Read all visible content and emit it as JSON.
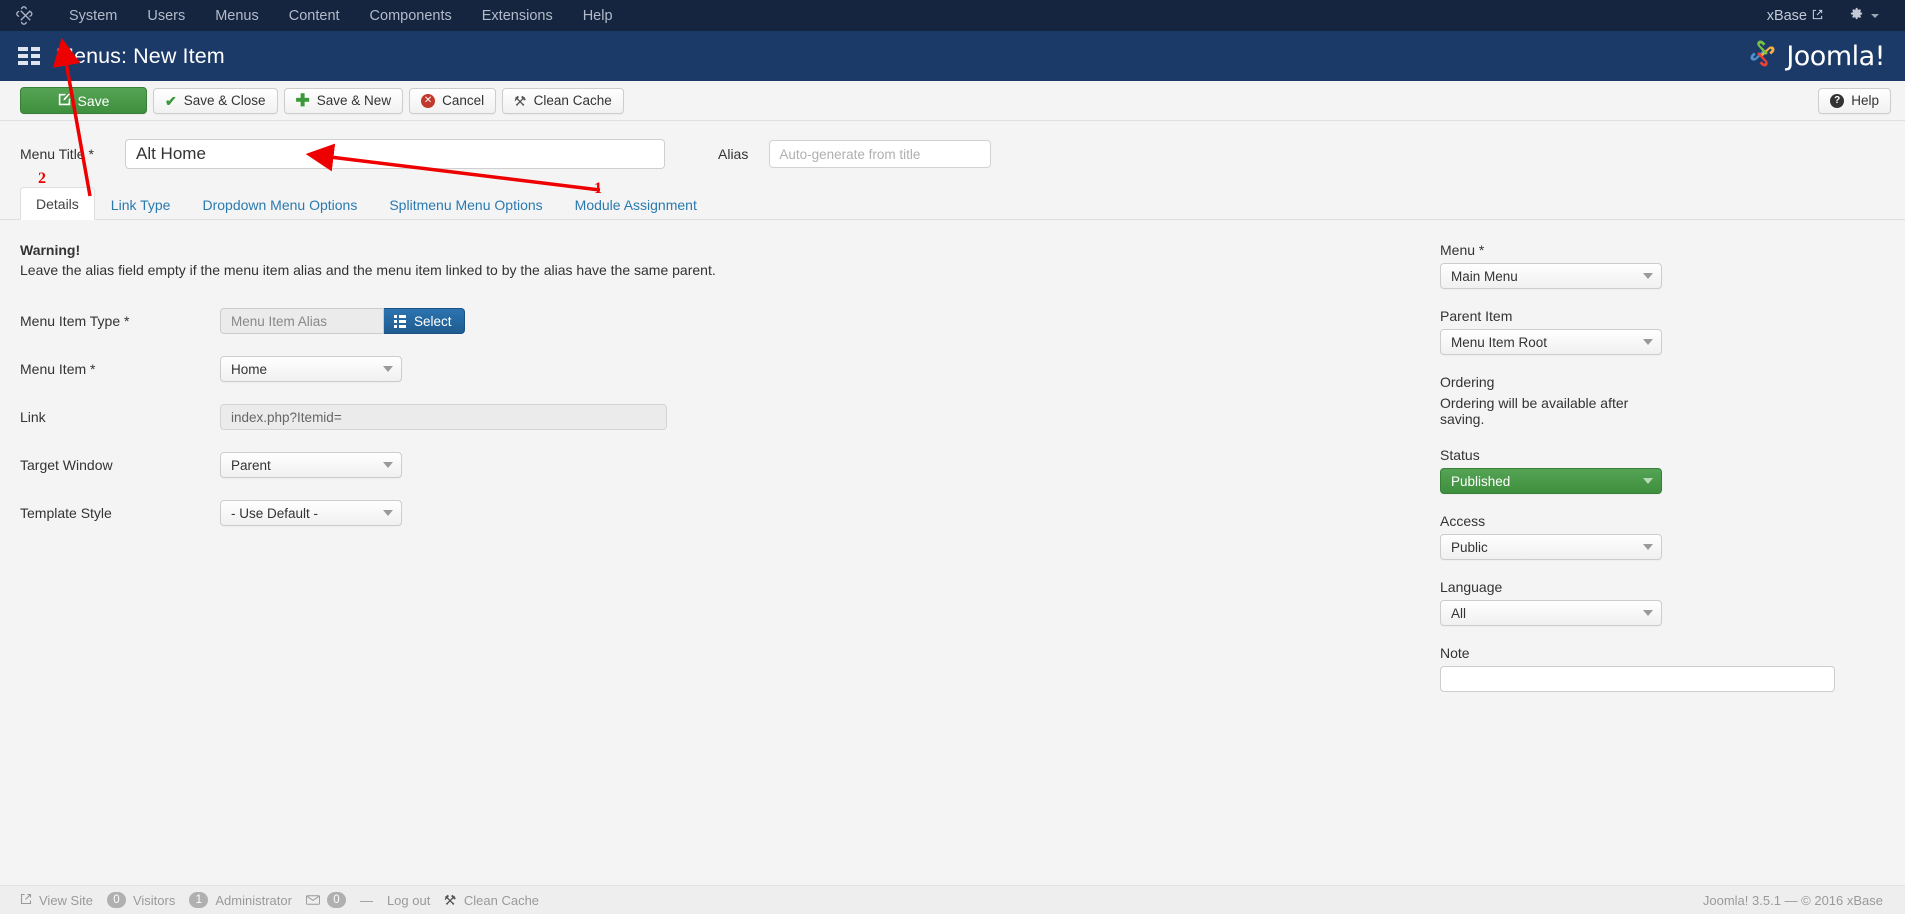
{
  "topbar": {
    "brand_icon": "joomla-mark-icon",
    "nav": [
      {
        "label": "System"
      },
      {
        "label": "Users"
      },
      {
        "label": "Menus"
      },
      {
        "label": "Content"
      },
      {
        "label": "Components"
      },
      {
        "label": "Extensions"
      },
      {
        "label": "Help"
      }
    ],
    "site_name": "xBase",
    "external_link_icon": "external-link-icon",
    "gear_icon": "gear-icon",
    "caret_icon": "chevron-down-icon"
  },
  "subheader": {
    "title": "Menus: New Item",
    "title_icon": "menu-list-icon",
    "logo_text": "Joomla!",
    "logo_mark": "joomla-logo-icon"
  },
  "toolbar": {
    "save": "Save",
    "save_close": "Save & Close",
    "save_new": "Save & New",
    "cancel": "Cancel",
    "clean_cache": "Clean Cache",
    "help": "Help",
    "save_color": "#3e8f3e"
  },
  "title_row": {
    "menu_title_label": "Menu Title *",
    "menu_title_value": "Alt Home",
    "alias_label": "Alias",
    "alias_value": "",
    "alias_placeholder": "Auto-generate from title"
  },
  "tabs": [
    {
      "label": "Details",
      "active": true
    },
    {
      "label": "Link Type",
      "active": false
    },
    {
      "label": "Dropdown Menu Options",
      "active": false
    },
    {
      "label": "Splitmenu Menu Options",
      "active": false
    },
    {
      "label": "Module Assignment",
      "active": false
    }
  ],
  "warning": {
    "heading": "Warning!",
    "text": "Leave the alias field empty if the menu item alias and the menu item linked to by the alias have the same parent."
  },
  "form_left": {
    "menu_item_type": {
      "label": "Menu Item Type *",
      "value": "Menu Item Alias",
      "select_button": "Select",
      "select_icon": "list-grid-icon"
    },
    "menu_item": {
      "label": "Menu Item *",
      "value": "Home"
    },
    "link": {
      "label": "Link",
      "value": "index.php?Itemid="
    },
    "target_window": {
      "label": "Target Window",
      "value": "Parent"
    },
    "template_style": {
      "label": "Template Style",
      "value": "- Use Default -"
    }
  },
  "form_right": {
    "menu": {
      "label": "Menu *",
      "value": "Main Menu"
    },
    "parent_item": {
      "label": "Parent Item",
      "value": "Menu Item Root"
    },
    "ordering": {
      "label": "Ordering",
      "note": "Ordering will be available after saving."
    },
    "status": {
      "label": "Status",
      "value": "Published",
      "color": "#3e8f3e"
    },
    "access": {
      "label": "Access",
      "value": "Public"
    },
    "language": {
      "label": "Language",
      "value": "All"
    },
    "note": {
      "label": "Note",
      "value": ""
    }
  },
  "footer": {
    "view_site": "View Site",
    "view_site_icon": "external-link-icon",
    "visitors_count": "0",
    "visitors_label": "Visitors",
    "admin_count": "1",
    "admin_label": "Administrator",
    "mail_icon": "envelope-icon",
    "mail_count": "0",
    "separator": "—",
    "log_out": "Log out",
    "clean_cache": "Clean Cache",
    "clean_cache_icon": "broom-icon",
    "version": "Joomla! 3.5.1  —  © 2016 xBase"
  },
  "annotations": {
    "arrow_1_number": "1",
    "arrow_2_number": "2",
    "color": "#ee0000"
  }
}
